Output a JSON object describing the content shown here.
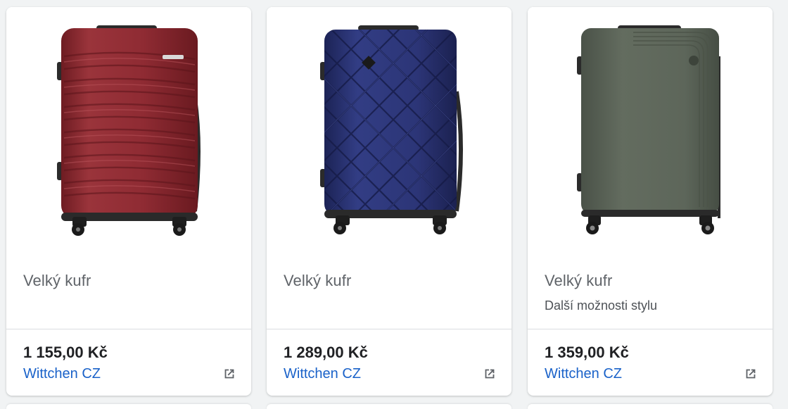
{
  "products": [
    {
      "title": "Velký kufr",
      "subtitle": "",
      "price": "1 155,00 Kč",
      "merchant": "Wittchen CZ",
      "image": "red-ribbed-suitcase",
      "color": "#8e2a31"
    },
    {
      "title": "Velký kufr",
      "subtitle": "",
      "price": "1 289,00 Kč",
      "merchant": "Wittchen CZ",
      "image": "navy-quilted-suitcase",
      "color": "#27306b"
    },
    {
      "title": "Velký kufr",
      "subtitle": "Další možnosti stylu",
      "price": "1 359,00 Kč",
      "merchant": "Wittchen CZ",
      "image": "olive-green-suitcase",
      "color": "#5c6559"
    }
  ],
  "icons": {
    "external_link": "open-in-new-icon"
  },
  "colors": {
    "link": "#1a62c9",
    "price": "#202124",
    "title": "#5f6368"
  }
}
